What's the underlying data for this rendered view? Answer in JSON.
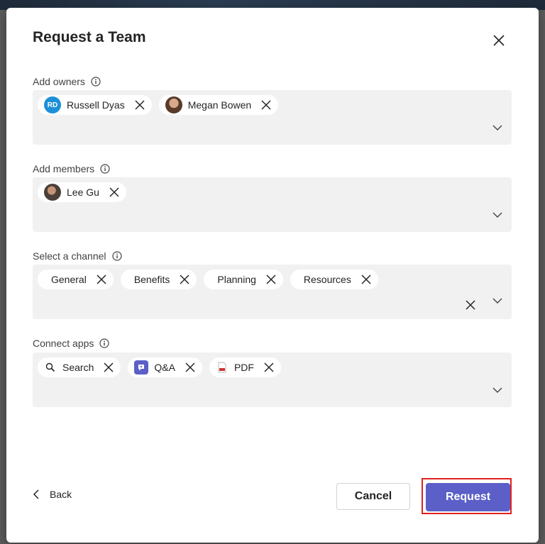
{
  "dialog": {
    "title": "Request a Team"
  },
  "sections": {
    "owners": {
      "label": "Add owners",
      "chips": [
        {
          "name": "Russell Dyas",
          "initials": "RD"
        },
        {
          "name": "Megan Bowen"
        }
      ]
    },
    "members": {
      "label": "Add members",
      "chips": [
        {
          "name": "Lee Gu"
        }
      ]
    },
    "channel": {
      "label": "Select a channel",
      "chips": [
        {
          "name": "General"
        },
        {
          "name": "Benefits"
        },
        {
          "name": "Planning"
        },
        {
          "name": "Resources"
        }
      ]
    },
    "apps": {
      "label": "Connect apps",
      "chips": [
        {
          "name": "Search",
          "icon": "search-icon"
        },
        {
          "name": "Q&A",
          "icon": "qa-app-icon"
        },
        {
          "name": "PDF",
          "icon": "pdf-icon"
        }
      ]
    }
  },
  "footer": {
    "back_label": "Back",
    "cancel_label": "Cancel",
    "request_label": "Request"
  },
  "colors": {
    "accent": "#5b5fc7",
    "highlight_outline": "#e02020",
    "field_bg": "#f1f1f1"
  }
}
